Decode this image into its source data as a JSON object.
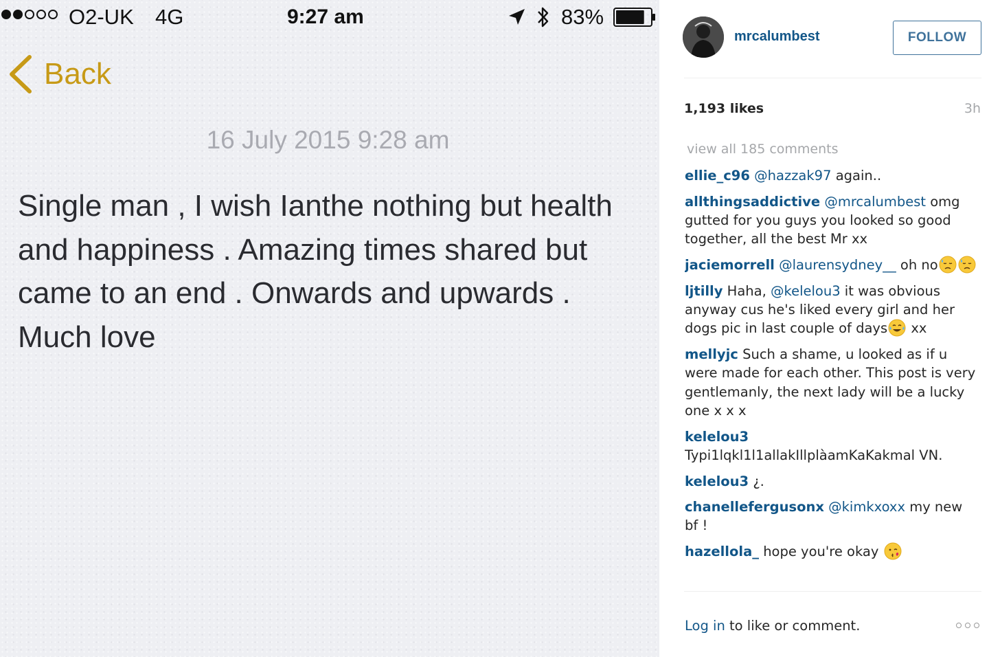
{
  "status_bar": {
    "carrier": "O2-UK",
    "network": "4G",
    "time": "9:27 am",
    "battery_percent": "83%",
    "battery_level": 0.83,
    "signal_bars_filled": 2,
    "signal_bars_total": 5,
    "icons": [
      "location-arrow-icon",
      "bluetooth-icon",
      "battery-icon"
    ]
  },
  "note": {
    "back_label": "Back",
    "date": "16 July 2015 9:28 am",
    "lines": [
      "Single man , I wish Ianthe nothing but health",
      "and happiness . Amazing times shared but",
      "came to an end . Onwards and upwards .",
      "Much love"
    ],
    "accent_color": "#c79a17"
  },
  "post": {
    "username": "mrcalumbest",
    "follow_label": "FOLLOW",
    "likes": "1,193 likes",
    "age": "3h",
    "view_all": "view all 185 comments",
    "link_color": "#125688"
  },
  "comments": [
    {
      "user": "ellie_c96",
      "parts": [
        {
          "t": "mention",
          "v": "@hazzak97"
        },
        {
          "t": "text",
          "v": " again.."
        }
      ]
    },
    {
      "user": "allthingsaddictive",
      "parts": [
        {
          "t": "mention",
          "v": "@mrcalumbest"
        },
        {
          "t": "text",
          "v": " omg gutted for you guys you looked so good together, all the best Mr xx"
        }
      ]
    },
    {
      "user": "jaciemorrell",
      "parts": [
        {
          "t": "mention",
          "v": "@laurensydney__"
        },
        {
          "t": "text",
          "v": " oh no"
        },
        {
          "t": "emoji",
          "v": "downcast-sweat-face-icon"
        },
        {
          "t": "emoji",
          "v": "downcast-sweat-face-icon"
        }
      ]
    },
    {
      "user": "ljtilly",
      "parts": [
        {
          "t": "text",
          "v": "Haha, "
        },
        {
          "t": "mention",
          "v": "@kelelou3"
        },
        {
          "t": "text",
          "v": " it was obvious anyway cus he's liked every girl and her dogs pic in last couple of days"
        },
        {
          "t": "emoji",
          "v": "tears-of-joy-face-icon"
        },
        {
          "t": "text",
          "v": " xx"
        }
      ]
    },
    {
      "user": "mellyjc",
      "parts": [
        {
          "t": "text",
          "v": "Such a shame, u looked as if u were made for each other. This post is very gentlemanly, the next lady will be a lucky one x x x"
        }
      ]
    },
    {
      "user": "kelelou3",
      "parts": [
        {
          "t": "text",
          "v": "Typi1lqkl1l1allakIllplàamKaKakmal VN."
        }
      ]
    },
    {
      "user": "kelelou3",
      "parts": [
        {
          "t": "text",
          "v": "¿."
        }
      ]
    },
    {
      "user": "chanellefergusonx",
      "parts": [
        {
          "t": "mention",
          "v": "@kimkxoxx"
        },
        {
          "t": "text",
          "v": " my new bf !"
        }
      ]
    },
    {
      "user": "hazellola_",
      "parts": [
        {
          "t": "text",
          "v": "hope you're okay "
        },
        {
          "t": "emoji",
          "v": "kissing-heart-face-icon"
        }
      ]
    }
  ],
  "footer": {
    "login_link": "Log in",
    "login_rest": " to like or comment.",
    "more_icon": "more-options-icon"
  }
}
